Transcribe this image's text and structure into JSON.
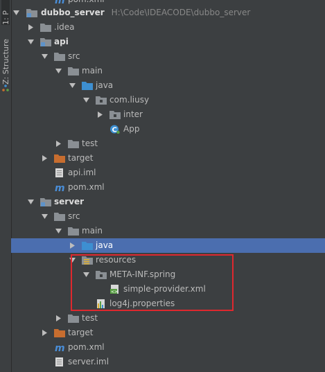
{
  "toolwindow_tabs": {
    "project": "1: P",
    "structure": "Z: Structure"
  },
  "tree": {
    "top_partial": "pom.xml",
    "project_root": {
      "name": "dubbo_server",
      "path": "H:\\Code\\IDEACODE\\dubbo_server"
    },
    "idea": ".idea",
    "api": {
      "name": "api",
      "src": "src",
      "main": "main",
      "java": "java",
      "package": "com.liusy",
      "inter": "inter",
      "app": "App",
      "test": "test",
      "target": "target",
      "iml": "api.iml",
      "pom": "pom.xml"
    },
    "server": {
      "name": "server",
      "src": "src",
      "main": "main",
      "java": "java",
      "resources": "resources",
      "meta_inf": "META-INF.spring",
      "provider_xml": "simple-provider.xml",
      "log4j": "log4j.properties",
      "test": "test",
      "target": "target",
      "pom": "pom.xml",
      "iml": "server.iml"
    }
  },
  "colors": {
    "background": "#3c3f41",
    "selection": "#4b6eaf",
    "highlight_box": "#e0282e",
    "folder": "#8a8f94",
    "source_folder": "#3d8fd1",
    "excluded_folder": "#c76d2f",
    "maven_m": "#4a8ed8",
    "class_icon": "#3d8fd1"
  }
}
